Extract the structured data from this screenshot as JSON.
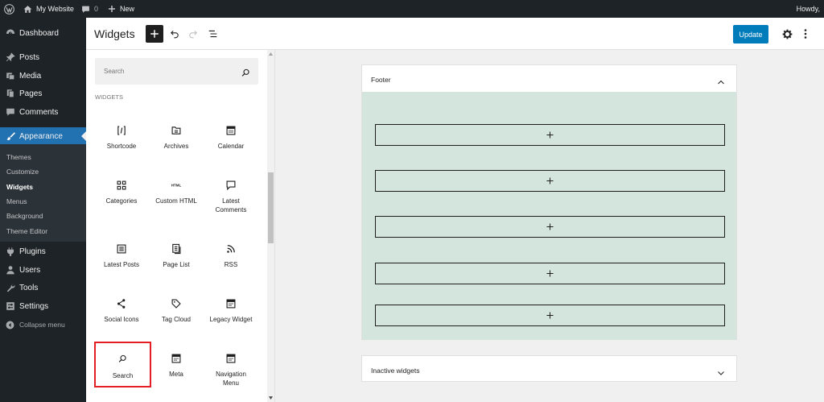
{
  "admin_bar": {
    "site_name": "My Website",
    "comments_count": "0",
    "new_label": "New",
    "howdy": "Howdy,"
  },
  "sidebar": {
    "items": [
      {
        "label": "Dashboard",
        "icon": "dashboard-icon"
      },
      {
        "label": "Posts",
        "icon": "pin-icon"
      },
      {
        "label": "Media",
        "icon": "media-icon"
      },
      {
        "label": "Pages",
        "icon": "pages-icon"
      },
      {
        "label": "Comments",
        "icon": "comment-icon"
      },
      {
        "label": "Appearance",
        "icon": "brush-icon"
      },
      {
        "label": "Plugins",
        "icon": "plug-icon"
      },
      {
        "label": "Users",
        "icon": "user-icon"
      },
      {
        "label": "Tools",
        "icon": "wrench-icon"
      },
      {
        "label": "Settings",
        "icon": "settings-icon"
      }
    ],
    "submenu": [
      "Themes",
      "Customize",
      "Widgets",
      "Menus",
      "Background",
      "Theme Editor"
    ],
    "current_sub": "Widgets",
    "collapse_label": "Collapse menu"
  },
  "header": {
    "title": "Widgets",
    "update_label": "Update"
  },
  "inserter": {
    "search_placeholder": "Search",
    "heading": "Widgets",
    "blocks": [
      {
        "label": "Shortcode",
        "icon": "shortcode-icon"
      },
      {
        "label": "Archives",
        "icon": "archive-icon"
      },
      {
        "label": "Calendar",
        "icon": "calendar-icon"
      },
      {
        "label": "Categories",
        "icon": "categories-icon"
      },
      {
        "label": "Custom HTML",
        "icon": "html-icon"
      },
      {
        "label": "Latest Comments",
        "icon": "comment-icon"
      },
      {
        "label": "Latest Posts",
        "icon": "post-list-icon"
      },
      {
        "label": "Page List",
        "icon": "page-list-icon"
      },
      {
        "label": "RSS",
        "icon": "rss-icon"
      },
      {
        "label": "Social Icons",
        "icon": "share-icon"
      },
      {
        "label": "Tag Cloud",
        "icon": "tag-icon"
      },
      {
        "label": "Legacy Widget",
        "icon": "widget-icon"
      },
      {
        "label": "Search",
        "icon": "search-icon"
      },
      {
        "label": "Meta",
        "icon": "meta-icon"
      },
      {
        "label": "Navigation Menu",
        "icon": "navigation-icon"
      }
    ]
  },
  "areas": {
    "footer_title": "Footer",
    "inactive_title": "Inactive widgets"
  },
  "colors": {
    "admin_dark": "#1d2327",
    "accent": "#2271b1",
    "update_button": "#007cba",
    "footer_area_bg": "#d4e5de",
    "highlight": "#e51e25"
  }
}
